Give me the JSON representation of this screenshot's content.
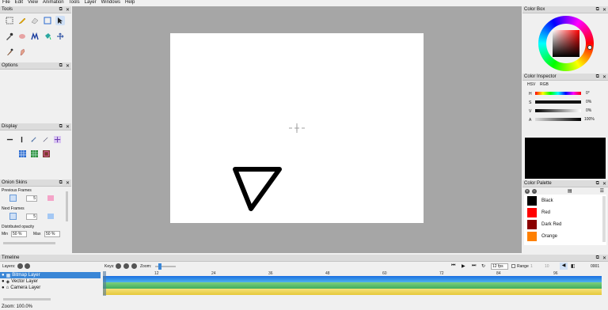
{
  "menu": [
    "File",
    "Edit",
    "View",
    "Animation",
    "Tools",
    "Layer",
    "Windows",
    "Help"
  ],
  "panels": {
    "tools": "Tools",
    "options": "Options",
    "display": "Display",
    "onion": "Onion Skins",
    "colorbox": "Color Box",
    "inspector": "Color Inspector",
    "palette": "Color Palette",
    "timeline": "Timeline"
  },
  "onion": {
    "previous_label": "Previous Frames",
    "previous_value": "5",
    "next_label": "Next Frames",
    "next_value": "5",
    "dist_label": "Distributed opacity",
    "min_label": "Min",
    "min_value": "50 %",
    "max_label": "Max",
    "max_value": "50 %"
  },
  "inspector": {
    "tabs": [
      "HSV",
      "RGB"
    ],
    "rows": [
      {
        "label": "H",
        "value": "0°"
      },
      {
        "label": "S",
        "value": "0%"
      },
      {
        "label": "V",
        "value": "0%"
      },
      {
        "label": "A",
        "value": "100%"
      }
    ],
    "current_color": "#000000"
  },
  "palette": {
    "colors": [
      {
        "name": "Black",
        "hex": "#000000"
      },
      {
        "name": "Red",
        "hex": "#ff0000"
      },
      {
        "name": "Dark Red",
        "hex": "#8b0000"
      },
      {
        "name": "Orange",
        "hex": "#ff8000"
      }
    ]
  },
  "timeline": {
    "layers_label": "Layers:",
    "keys_label": "Keys:",
    "zoom_label": "Zoom:",
    "fps_value": "12 fps",
    "range_label": "Range",
    "range_start": "1",
    "range_end": "10",
    "frame_value": "0001",
    "ruler": [
      "12",
      "24",
      "36",
      "48",
      "60",
      "72",
      "84",
      "96"
    ],
    "layers": [
      {
        "name": "Bitmap Layer",
        "selected": true
      },
      {
        "name": "Vector Layer",
        "selected": false
      },
      {
        "name": "Camera Layer",
        "selected": false
      }
    ]
  },
  "status": {
    "zoom": "Zoom: 100.0%"
  },
  "colors": {
    "canvas_bg": "#a6a6a6",
    "selection": "#3a86d6"
  }
}
